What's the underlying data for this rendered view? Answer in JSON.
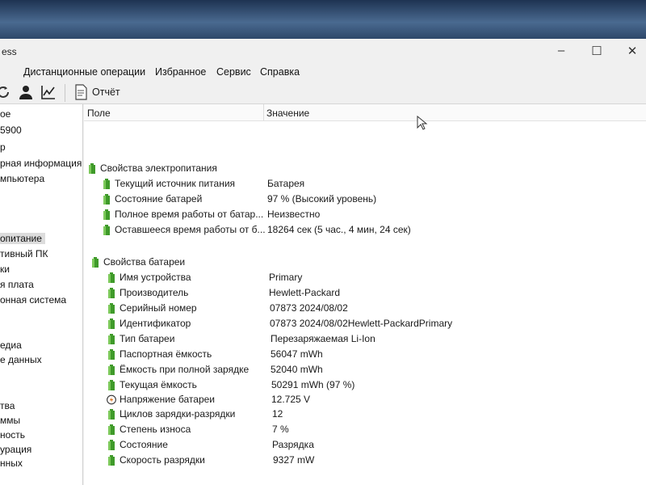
{
  "window": {
    "title": "ess"
  },
  "menu": [
    "Дистанционные операции",
    "Избранное",
    "Сервис",
    "Справка"
  ],
  "toolbar": {
    "report_label": "Отчёт"
  },
  "sidebar": {
    "items": [
      "ое",
      "5900",
      "р",
      "рная информация",
      "мпьютера",
      "опитание",
      "тивный ПК",
      "ки",
      "я плата",
      "онная система",
      "едиа",
      "е данных",
      "тва",
      "ммы",
      "ность",
      "урация",
      "нных"
    ],
    "selected_index": 5
  },
  "columns": {
    "field": "Поле",
    "value": "Значение"
  },
  "power_group": {
    "title": "Свойства электропитания",
    "rows": [
      {
        "name": "Текущий источник питания",
        "value": "Батарея"
      },
      {
        "name": "Состояние батарей",
        "value": "97 % (Высокий уровень)"
      },
      {
        "name": "Полное время работы от батар...",
        "value": "Неизвестно"
      },
      {
        "name": "Оставшееся время работы от б...",
        "value": "18264 сек (5 час., 4 мин, 24 сек)"
      }
    ]
  },
  "battery_group": {
    "title": "Свойства батареи",
    "rows": [
      {
        "name": "Имя устройства",
        "value": "Primary"
      },
      {
        "name": "Производитель",
        "value": "Hewlett-Packard"
      },
      {
        "name": "Серийный номер",
        "value": "07873 2024/08/02"
      },
      {
        "name": "Идентификатор",
        "value": "07873 2024/08/02Hewlett-PackardPrimary"
      },
      {
        "name": "Тип батареи",
        "value": "Перезаряжаемая Li-Ion"
      },
      {
        "name": "Паспортная ёмкость",
        "value": "56047 mWh"
      },
      {
        "name": "Ёмкость при полной зарядке",
        "value": "52040 mWh"
      },
      {
        "name": "Текущая ёмкость",
        "value": "50291 mWh  (97 %)"
      },
      {
        "name": "Напряжение батареи",
        "value": "12.725 V"
      },
      {
        "name": "Циклов зарядки-разрядки",
        "value": "12"
      },
      {
        "name": "Степень износа",
        "value": "7 %"
      },
      {
        "name": "Состояние",
        "value": "Разрядка"
      },
      {
        "name": "Скорость разрядки",
        "value": "9327 mW"
      }
    ]
  }
}
